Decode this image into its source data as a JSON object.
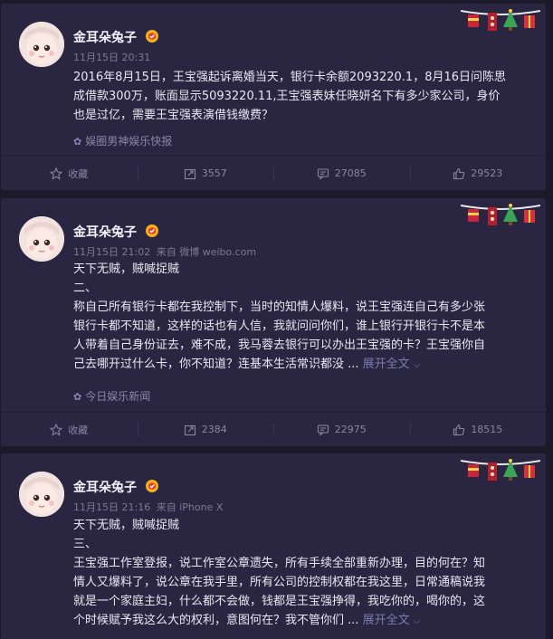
{
  "posts": [
    {
      "author": "金耳朵兔子",
      "time": "11月15日 20:31",
      "source_prefix": "",
      "source": "",
      "lines": [
        "2016年8月15日，王宝强起诉离婚当天，银行卡余额2093220.1，8月16日问陈思",
        "成借款300万，账面显示5093220.11,王宝强表妹任晓妍名下有多少家公司，身价",
        "也是过亿，需要王宝强表演借钱缴费？"
      ],
      "more_label": "",
      "tag": "娱圈男神娱乐快报",
      "actions": {
        "fav": "收藏",
        "repost": "3557",
        "comment": "27085",
        "like": "29523"
      }
    },
    {
      "author": "金耳朵兔子",
      "time": "11月15日 21:02",
      "source_prefix": "来自",
      "source": "微博 weibo.com",
      "lines": [
        "天下无贼，贼喊捉贼",
        "二、",
        "称自己所有银行卡都在我控制下，当时的知情人爆料，说王宝强连自己有多少张",
        "银行卡都不知道，这样的话也有人信，我就问问你们，谁上银行开银行卡不是本",
        "人带着自己身份证去，难不成，我马蓉去银行可以办出王宝强的卡？王宝强你自",
        "己去哪开过什么卡，你不知道？连基本生活常识都没 ..."
      ],
      "more_label": "展开全文",
      "tag": "今日娱乐新闻",
      "actions": {
        "fav": "收藏",
        "repost": "2384",
        "comment": "22975",
        "like": "18515"
      }
    },
    {
      "author": "金耳朵兔子",
      "time": "11月15日 21:16",
      "source_prefix": "来自",
      "source": "iPhone X",
      "lines": [
        "天下无贼，贼喊捉贼",
        "三、",
        "王宝强工作室登报，说工作室公章遗失，所有手续全部重新办理，目的何在？知",
        "情人又爆料了，说公章在我手里，所有公司的控制权都在我这里，日常通稿说我",
        "就是一个家庭主妇，什么都不会做，钱都是王宝强挣得，我吃你的，喝你的，这",
        "个时候赋予我这么大的权利，意图何在？我不管你们 ..."
      ],
      "more_label": "展开全文",
      "tag": "",
      "actions": {
        "fav": "",
        "repost": "",
        "comment": "",
        "like": ""
      }
    }
  ],
  "colors": {
    "background": "#1c1a2a",
    "card": "#2a2540",
    "link": "#7d7ab0",
    "muted": "#7d7895"
  },
  "icons": [
    "star-icon",
    "repost-icon",
    "comment-icon",
    "like-icon",
    "verified-badge-icon",
    "topic-flower-icon",
    "christmas-decoration"
  ]
}
